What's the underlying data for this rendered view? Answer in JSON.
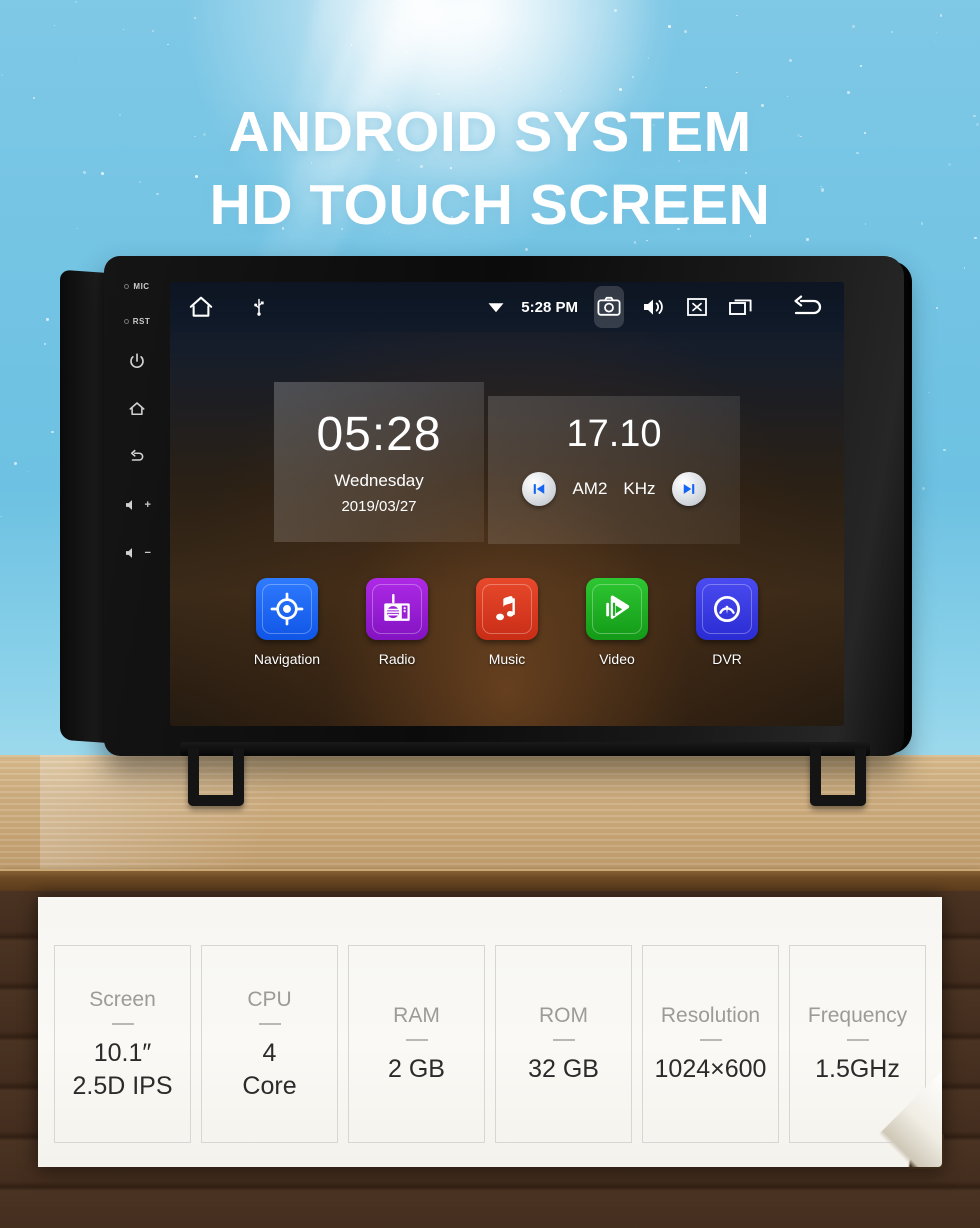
{
  "headline": {
    "line1": "ANDROID SYSTEM",
    "line2": "HD TOUCH SCREEN"
  },
  "colors": {
    "sky": "#6dc1e2",
    "wood_top": "#c9a87a",
    "wood_edge": "#6d4a25",
    "plank_dark": "#432d1e",
    "sheet": "#f7f6f2",
    "accent_blue": "#1565f5",
    "nav_tile": "#1f6dff",
    "radio_tile": "#9b1fd4",
    "music_tile": "#dd3a22",
    "video_tile": "#1eb022",
    "dvr_tile": "#3b3ce0"
  },
  "device": {
    "side_buttons": [
      {
        "name": "mic",
        "label": "MIC",
        "type": "pinhole"
      },
      {
        "name": "reset",
        "label": "RST",
        "type": "pinhole"
      },
      {
        "name": "power",
        "label": "",
        "type": "icon"
      },
      {
        "name": "home",
        "label": "",
        "type": "icon"
      },
      {
        "name": "back",
        "label": "",
        "type": "icon"
      },
      {
        "name": "volume-up",
        "label": "+",
        "type": "icon"
      },
      {
        "name": "volume-down",
        "label": "−",
        "type": "icon"
      }
    ],
    "statusbar": {
      "home_icon": "home-icon",
      "usb_icon": "usb-icon",
      "wifi_icon": "wifi-icon",
      "time": "5:28 PM",
      "camera_icon": "camera-icon",
      "volume_icon": "volume-icon",
      "close_icon": "close-box-icon",
      "recents_icon": "recents-icon",
      "back_icon": "back-arrow-icon"
    },
    "clock_widget": {
      "time": "05:28",
      "weekday": "Wednesday",
      "date": "2019/03/27"
    },
    "radio_widget": {
      "frequency": "17.10",
      "band": "AM2",
      "unit": "KHz",
      "prev_icon": "skip-previous-icon",
      "next_icon": "skip-next-icon"
    },
    "apps": [
      {
        "label": "Navigation",
        "icon": "navigation-target-icon",
        "color": "#1f6dff"
      },
      {
        "label": "Radio",
        "icon": "radio-set-icon",
        "color": "#9b1fd4"
      },
      {
        "label": "Music",
        "icon": "music-note-icon",
        "color": "#dd3a22"
      },
      {
        "label": "Video",
        "icon": "video-play-icon",
        "color": "#1eb022"
      },
      {
        "label": "DVR",
        "icon": "gauge-icon",
        "color": "#3b3ce0"
      }
    ]
  },
  "specs": [
    {
      "label": "Screen",
      "value": "10.1″\n2.5D IPS"
    },
    {
      "label": "CPU",
      "value": "4\nCore"
    },
    {
      "label": "RAM",
      "value": "2 GB"
    },
    {
      "label": "ROM",
      "value": "32 GB"
    },
    {
      "label": "Resolution",
      "value": "1024×600"
    },
    {
      "label": "Frequency",
      "value": "1.5GHz"
    }
  ]
}
